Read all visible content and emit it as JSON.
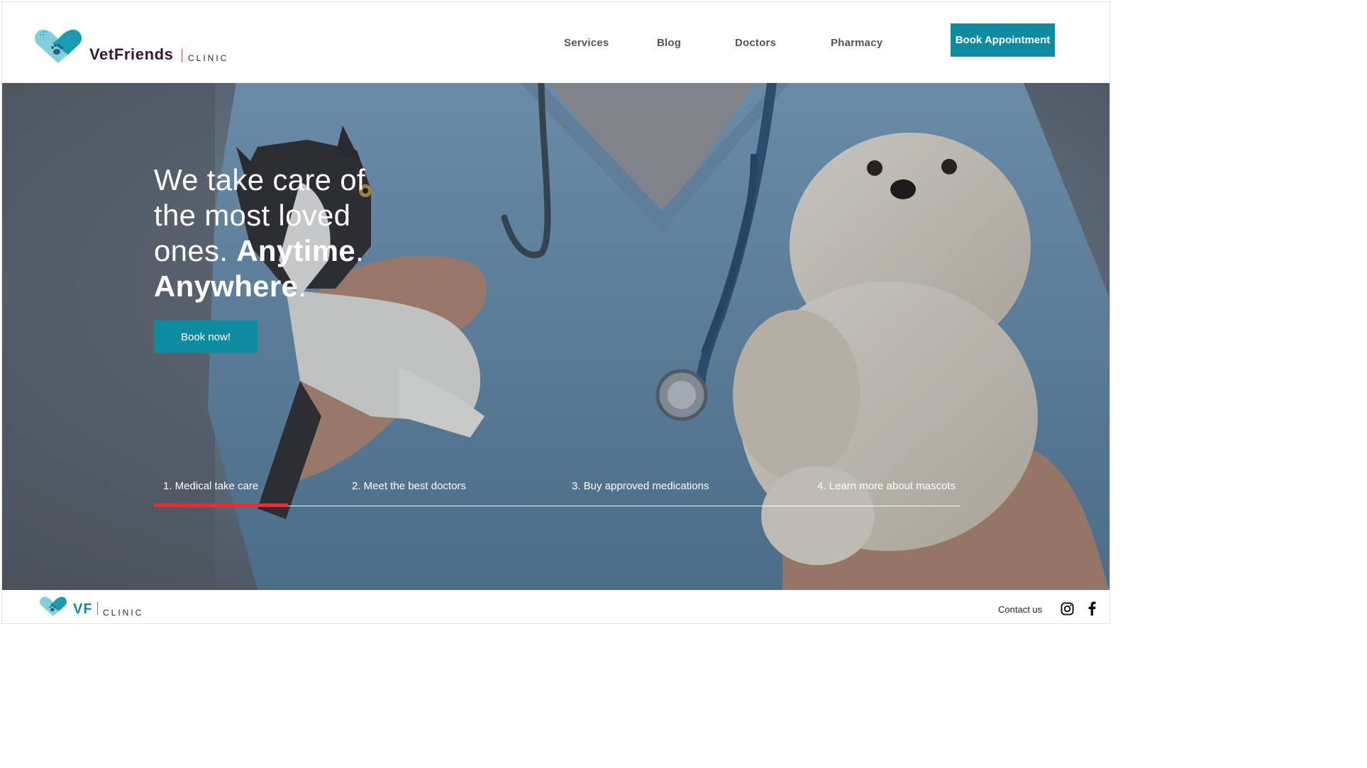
{
  "brand": {
    "name": "VetFriends",
    "sub": "CLINIC",
    "short": "VF",
    "colors": {
      "teal": "#0f8ba1",
      "light_teal": "#5fc3d2",
      "plum": "#3a1834",
      "accent_red": "#d9343d"
    }
  },
  "nav": {
    "items": [
      "Services",
      "Blog",
      "Doctors",
      "Pharmacy"
    ],
    "cta": "Book Appointment"
  },
  "hero": {
    "headline_light_1": "We take care of",
    "headline_light_2": "the most loved",
    "headline_light_3": "ones. ",
    "headline_bold_1": "Anytime",
    "headline_bold_2": "Anywhere",
    "period": ".",
    "button": "Book now!",
    "image_icons": [
      "kitten",
      "vet-scrubs",
      "stethoscope",
      "white-dog"
    ]
  },
  "steps": {
    "items": [
      "1. Medical take care",
      "2. Meet the best doctors",
      "3. Buy approved medications",
      "4. Learn more about mascots"
    ],
    "active_index": 0
  },
  "footer": {
    "contact": "Contact us",
    "social": [
      "instagram-icon",
      "facebook-icon"
    ]
  }
}
